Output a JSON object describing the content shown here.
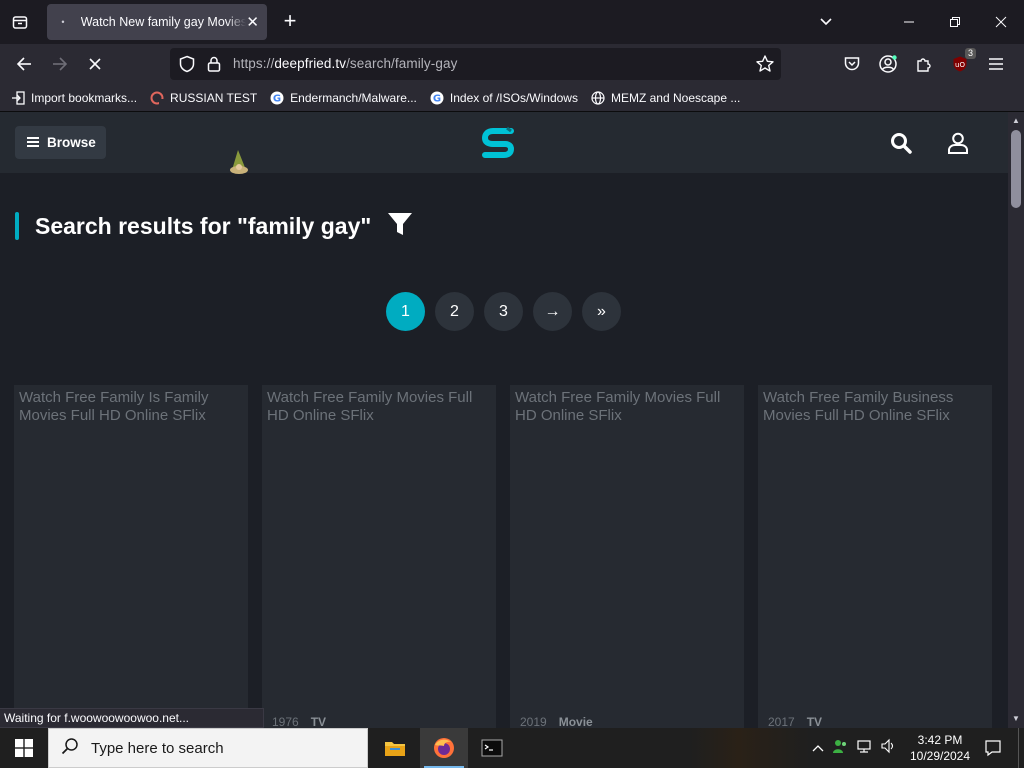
{
  "browser": {
    "tab": {
      "title": "Watch New family gay Movies Full HD Online"
    },
    "url": {
      "scheme": "https://",
      "host": "deepfried.tv",
      "path": "/search/family-gay"
    },
    "bookmarks": [
      {
        "label": "Import bookmarks...",
        "icon": "import-icon"
      },
      {
        "label": "RUSSIAN TEST",
        "icon": "site-icon"
      },
      {
        "label": "Endermanch/Malware...",
        "icon": "google-icon"
      },
      {
        "label": "Index of /ISOs/Windows",
        "icon": "google-icon"
      },
      {
        "label": "MEMZ and Noescape ...",
        "icon": "globe-icon"
      }
    ],
    "ublock_count": "3",
    "status_text": "Waiting for f.woowoowoowoo.net..."
  },
  "site": {
    "browse_label": "Browse",
    "results_title": "Search results for \"family gay\"",
    "pagination": [
      {
        "label": "1",
        "active": true
      },
      {
        "label": "2",
        "active": false
      },
      {
        "label": "3",
        "active": false
      },
      {
        "label": "→",
        "active": false
      },
      {
        "label": "»",
        "active": false
      }
    ],
    "cards": [
      {
        "title": "Watch Free Family Is Family Movies Full HD Online SFlix",
        "year": "",
        "type": ""
      },
      {
        "title": "Watch Free Family Movies Full HD Online SFlix",
        "year": "1976",
        "type": "TV"
      },
      {
        "title": "Watch Free Family Movies Full HD Online SFlix",
        "year": "2019",
        "type": "Movie"
      },
      {
        "title": "Watch Free Family Business Movies Full HD Online SFlix",
        "year": "2017",
        "type": "TV"
      }
    ],
    "accent_color": "#00acc1"
  },
  "taskbar": {
    "search_placeholder": "Type here to search",
    "time": "3:42 PM",
    "date": "10/29/2024"
  }
}
